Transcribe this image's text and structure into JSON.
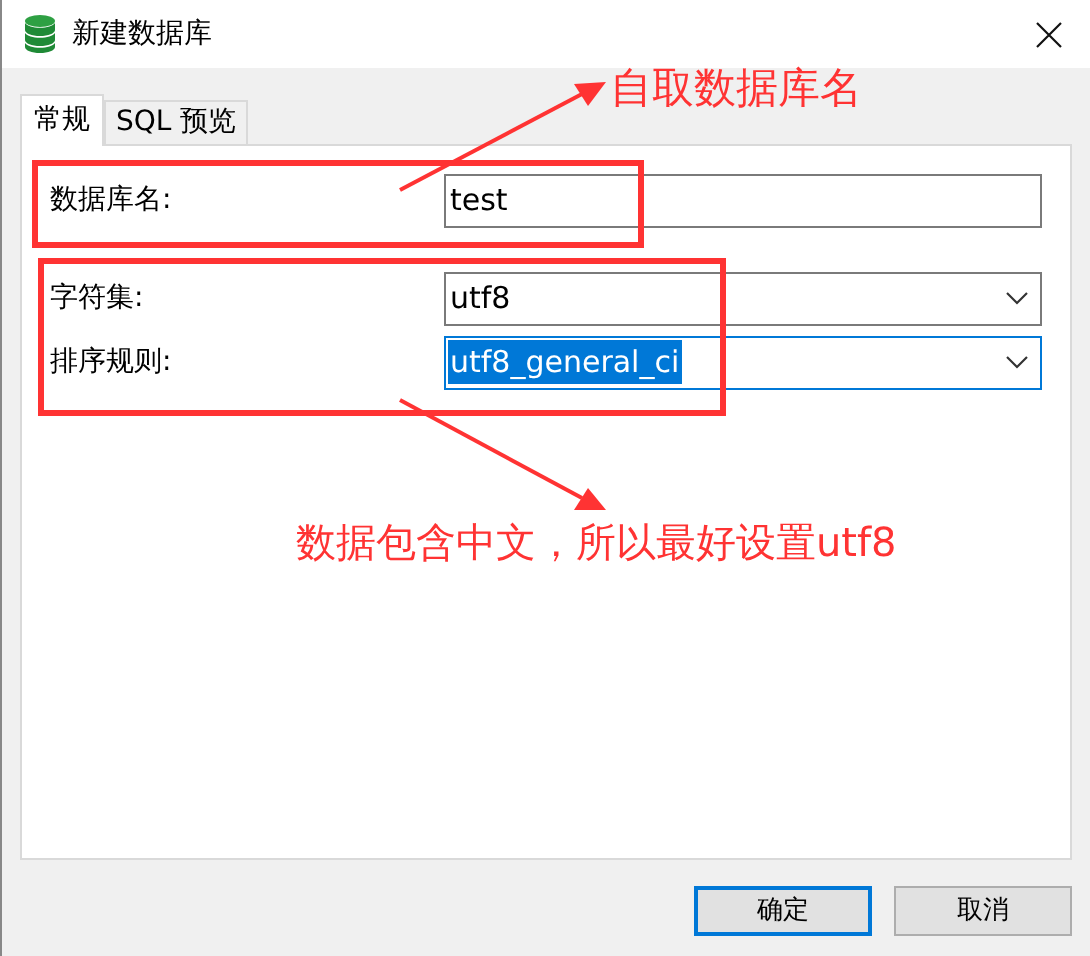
{
  "window": {
    "title": "新建数据库"
  },
  "tabs": [
    {
      "label": "常规",
      "selected": true
    },
    {
      "label": "SQL 预览",
      "selected": false
    }
  ],
  "fields": [
    {
      "label": "数据库名:",
      "kind": "text",
      "value": "test",
      "focused": false,
      "text_selected": false
    },
    {
      "label": "字符集:",
      "kind": "select",
      "value": "utf8",
      "focused": false,
      "text_selected": false
    },
    {
      "label": "排序规则:",
      "kind": "select",
      "value": "utf8_general_ci",
      "focused": true,
      "text_selected": true
    }
  ],
  "buttons": [
    {
      "label": "确定",
      "default": true
    },
    {
      "label": "取消",
      "default": false
    }
  ],
  "annotations": [
    {
      "text": "自取数据库名"
    },
    {
      "text": "数据包含中文，所以最好设置utf8"
    }
  ]
}
